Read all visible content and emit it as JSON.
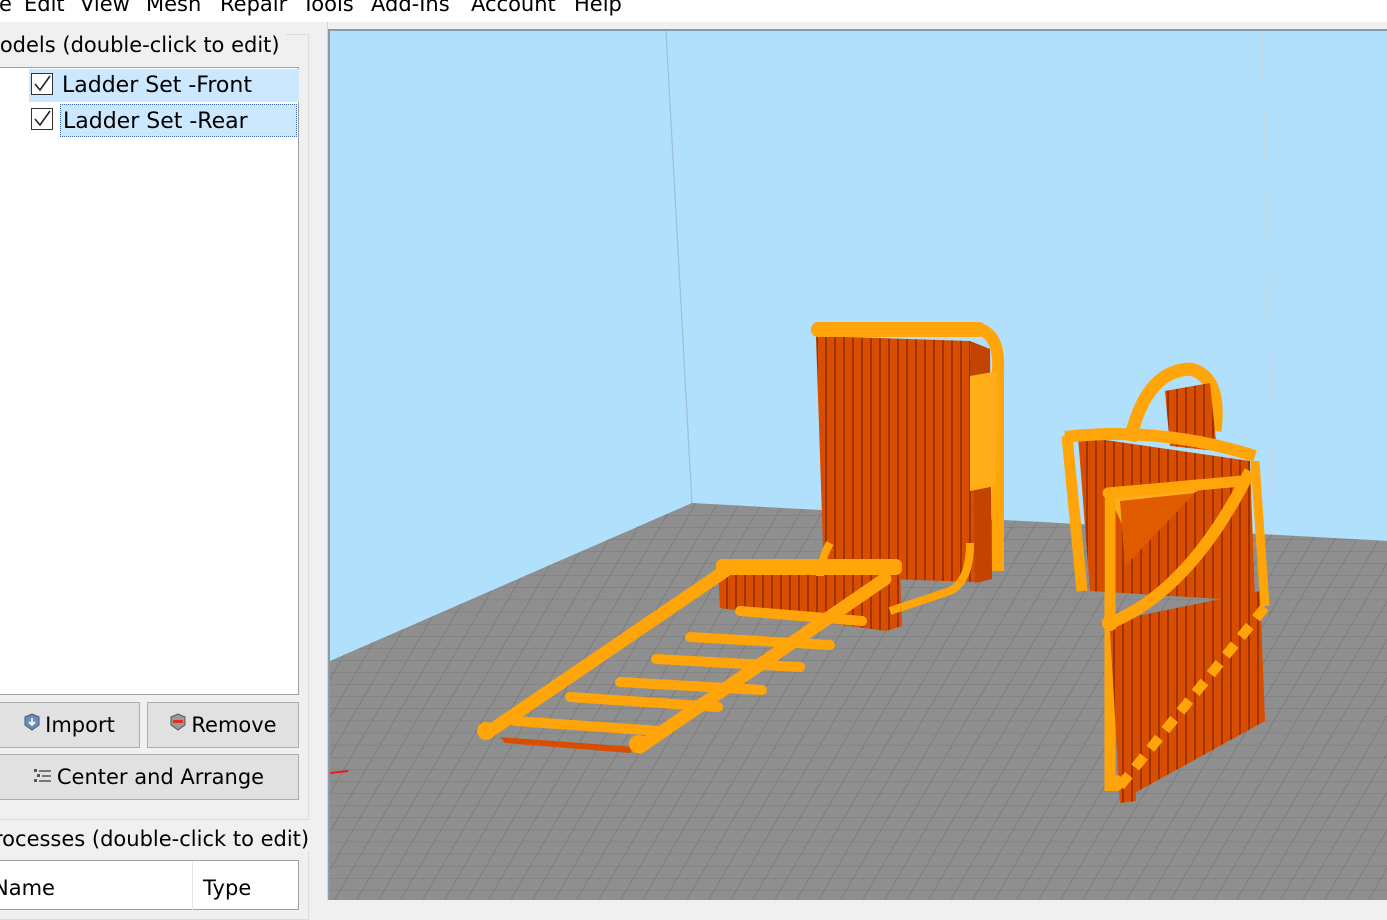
{
  "menu": {
    "items": [
      "e",
      "Edit",
      "View",
      "Mesh",
      "Repair",
      "Tools",
      "Add-Ins",
      "Account",
      "Help"
    ]
  },
  "models_panel": {
    "label": "lodels (double-click to edit)",
    "items": [
      {
        "label": "Ladder Set -Front",
        "checked": true,
        "selected": true
      },
      {
        "label": "Ladder Set -Rear",
        "checked": true,
        "selected": true,
        "focused": true
      }
    ],
    "import_label": "Import",
    "remove_label": "Remove",
    "center_arrange_label": "Center and Arrange"
  },
  "processes_panel": {
    "label": "rocesses (double-click to edit)",
    "columns": [
      "Name",
      "Type"
    ]
  },
  "viewport": {
    "background_color": "#b0e0fb",
    "bed_color": "#8f8f8f",
    "model_colors": [
      "#ffa50a",
      "#d84d00"
    ]
  }
}
